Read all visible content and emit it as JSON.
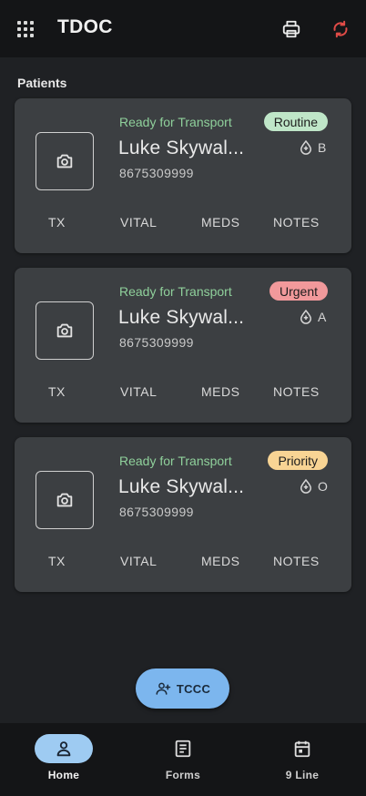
{
  "header": {
    "title": "TDOC",
    "menu_icon": "apps-grid-icon",
    "print_icon": "printer-icon",
    "sync_icon": "sync-icon",
    "sync_color": "#e04b47"
  },
  "section_label": "Patients",
  "patients": [
    {
      "status": "Ready for Transport",
      "name": "Luke Skywal...",
      "phone": "8675309999",
      "priority": "Routine",
      "priority_color": "#bfe6c8",
      "blood_type": "B",
      "actions": [
        "TX",
        "VITAL",
        "MEDS",
        "NOTES"
      ]
    },
    {
      "status": "Ready for Transport",
      "name": "Luke Skywal...",
      "phone": "8675309999",
      "priority": "Urgent",
      "priority_color": "#f1999b",
      "blood_type": "A",
      "actions": [
        "TX",
        "VITAL",
        "MEDS",
        "NOTES"
      ]
    },
    {
      "status": "Ready for Transport",
      "name": "Luke Skywal...",
      "phone": "8675309999",
      "priority": "Priority",
      "priority_color": "#f8d494",
      "blood_type": "O",
      "actions": [
        "TX",
        "VITAL",
        "MEDS",
        "NOTES"
      ]
    }
  ],
  "fab": {
    "label": "TCCC",
    "icon": "add-person-icon",
    "color": "#7cb6ee"
  },
  "bottom_nav": [
    {
      "label": "Home",
      "icon": "home-icon",
      "active": true
    },
    {
      "label": "Forms",
      "icon": "document-icon",
      "active": false
    },
    {
      "label": "9 Line",
      "icon": "calendar-icon",
      "active": false
    }
  ]
}
